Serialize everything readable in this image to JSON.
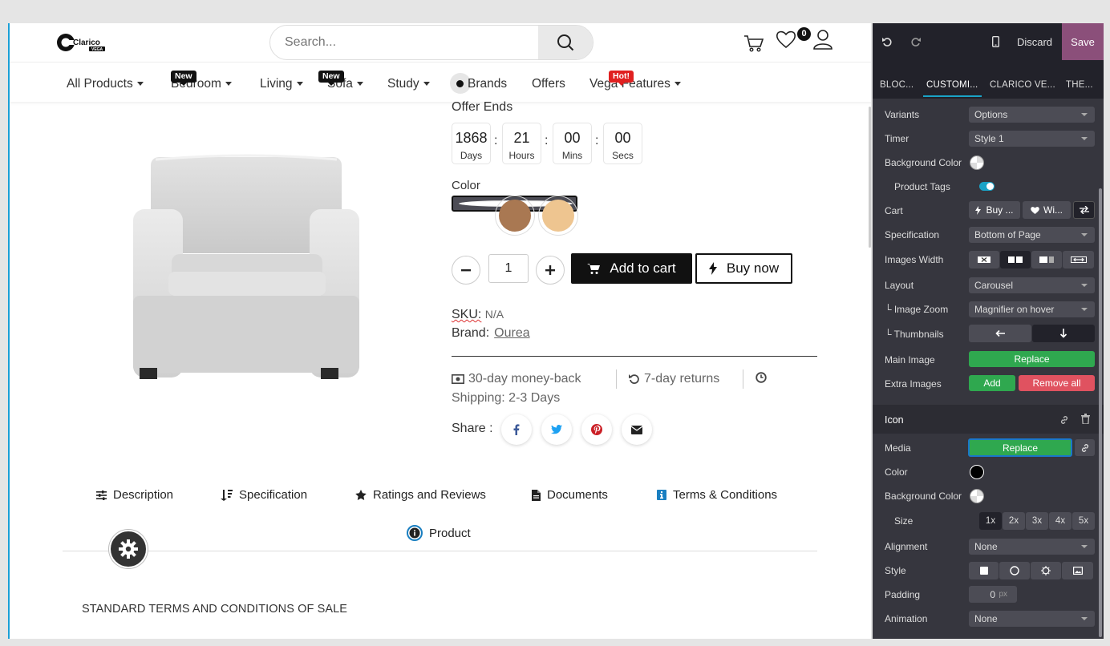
{
  "header": {
    "logo_text": "Clarico",
    "logo_sub": "VEGA",
    "search_placeholder": "Search...",
    "wishlist_count": "0"
  },
  "nav": {
    "items": [
      {
        "label": "All Products",
        "tag": ""
      },
      {
        "label": "Bedroom",
        "tag": "New"
      },
      {
        "label": "Living",
        "tag": ""
      },
      {
        "label": "Sofa",
        "tag": "New"
      },
      {
        "label": "Study",
        "tag": ""
      },
      {
        "label": "Brands",
        "tag": ""
      },
      {
        "label": "Offers",
        "tag": ""
      },
      {
        "label": "Vega Features",
        "tag": "Hot!"
      }
    ]
  },
  "product": {
    "offer_title": "Offer Ends",
    "timer": [
      {
        "value": "1868",
        "unit": "Days"
      },
      {
        "value": "21",
        "unit": "Hours"
      },
      {
        "value": "00",
        "unit": "Mins"
      },
      {
        "value": "00",
        "unit": "Secs"
      }
    ],
    "color_label": "Color",
    "colors": [
      "#ffffff",
      "#a97852",
      "#eec590"
    ],
    "quantity": "1",
    "add_to_cart": "Add to cart",
    "buy_now": "Buy now",
    "sku_label": "SKU:",
    "sku_value": "N/A",
    "brand_label": "Brand:",
    "brand_value": "Ourea",
    "money_back": "30-day money-back",
    "returns": "7-day returns",
    "shipping": "Shipping: 2-3 Days",
    "share_label": "Share :"
  },
  "tabs": {
    "description": "Description",
    "specification": "Specification",
    "ratings": "Ratings and Reviews",
    "documents": "Documents",
    "terms": "Terms & Conditions",
    "product": "Product"
  },
  "content": {
    "terms_heading": "STANDARD TERMS AND CONDITIONS OF SALE"
  },
  "panel": {
    "discard": "Discard",
    "save": "Save",
    "tabs": [
      "BLOC...",
      "CUSTOMI...",
      "CLARICO VE...",
      "THE..."
    ],
    "rows": {
      "variants": {
        "label": "Variants",
        "value": "Options"
      },
      "timer": {
        "label": "Timer",
        "value": "Style 1"
      },
      "bg_color": {
        "label": "Background Color"
      },
      "product_tags": {
        "label": "Product Tags"
      },
      "cart": {
        "label": "Cart",
        "buy": "Buy ...",
        "wish": "Wi..."
      },
      "specification": {
        "label": "Specification",
        "value": "Bottom of Page"
      },
      "images_width": {
        "label": "Images Width"
      },
      "layout": {
        "label": "Layout",
        "value": "Carousel"
      },
      "image_zoom": {
        "label": "└ Image Zoom",
        "value": "Magnifier on hover"
      },
      "thumbnails": {
        "label": "└ Thumbnails"
      },
      "main_image": {
        "label": "Main Image",
        "button": "Replace"
      },
      "extra_images": {
        "label": "Extra Images",
        "add": "Add",
        "remove": "Remove all"
      }
    },
    "icon_section": {
      "title": "Icon",
      "media": {
        "label": "Media",
        "button": "Replace"
      },
      "color": {
        "label": "Color"
      },
      "bg_color": {
        "label": "Background Color"
      },
      "size": {
        "label": "Size",
        "options": [
          "1x",
          "2x",
          "3x",
          "4x",
          "5x"
        ]
      },
      "alignment": {
        "label": "Alignment",
        "value": "None"
      },
      "style": {
        "label": "Style"
      },
      "padding": {
        "label": "Padding",
        "value": "0",
        "unit": "px"
      },
      "animation": {
        "label": "Animation",
        "value": "None"
      }
    }
  },
  "colors": {
    "accent": "#1aa3c7",
    "save": "#8b4f7a",
    "green": "#2fa84f",
    "red": "#e05260",
    "panel": "#36363e"
  }
}
